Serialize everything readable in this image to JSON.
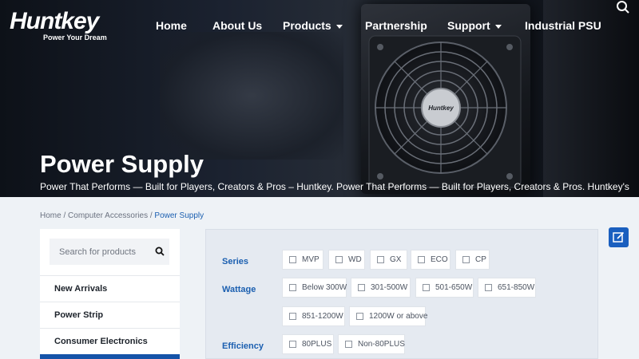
{
  "header": {
    "brand": "Huntkey",
    "tagline": "Power Your Dream",
    "nav": [
      {
        "label": "Home"
      },
      {
        "label": "About Us"
      },
      {
        "label": "Products",
        "dropdown": true
      },
      {
        "label": "Partnership"
      },
      {
        "label": "Support",
        "dropdown": true
      },
      {
        "label": "Industrial PSU"
      }
    ],
    "search_icon": "search-icon"
  },
  "hero": {
    "title": "Power Supply",
    "subtitle": "Power That Performs — Built for Players, Creators & Pros – Huntkey. Power That Performs — Built for Players, Creators & Pros. Huntkey's",
    "product_brand": "Huntkey"
  },
  "breadcrumb": {
    "items": [
      "Home",
      "Computer Accessories",
      "Power Supply"
    ],
    "separator": "/"
  },
  "sidebar": {
    "search_placeholder": "Search for products",
    "items": [
      {
        "label": "New Arrivals"
      },
      {
        "label": "Power Strip"
      },
      {
        "label": "Consumer Electronics"
      }
    ]
  },
  "filters": {
    "series": {
      "label": "Series",
      "options": [
        "MVP",
        "WD",
        "GX",
        "ECO",
        "CP"
      ]
    },
    "wattage": {
      "label": "Wattage",
      "options": [
        "Below 300W",
        "301-500W",
        "501-650W",
        "651-850W",
        "851-1200W",
        "1200W or above"
      ]
    },
    "efficiency": {
      "label": "Efficiency",
      "options": [
        "80PLUS",
        "Non-80PLUS"
      ]
    }
  },
  "colors": {
    "accent": "#1b5fb0",
    "active": "#1553a8",
    "float_button": "#1a5fbf"
  }
}
